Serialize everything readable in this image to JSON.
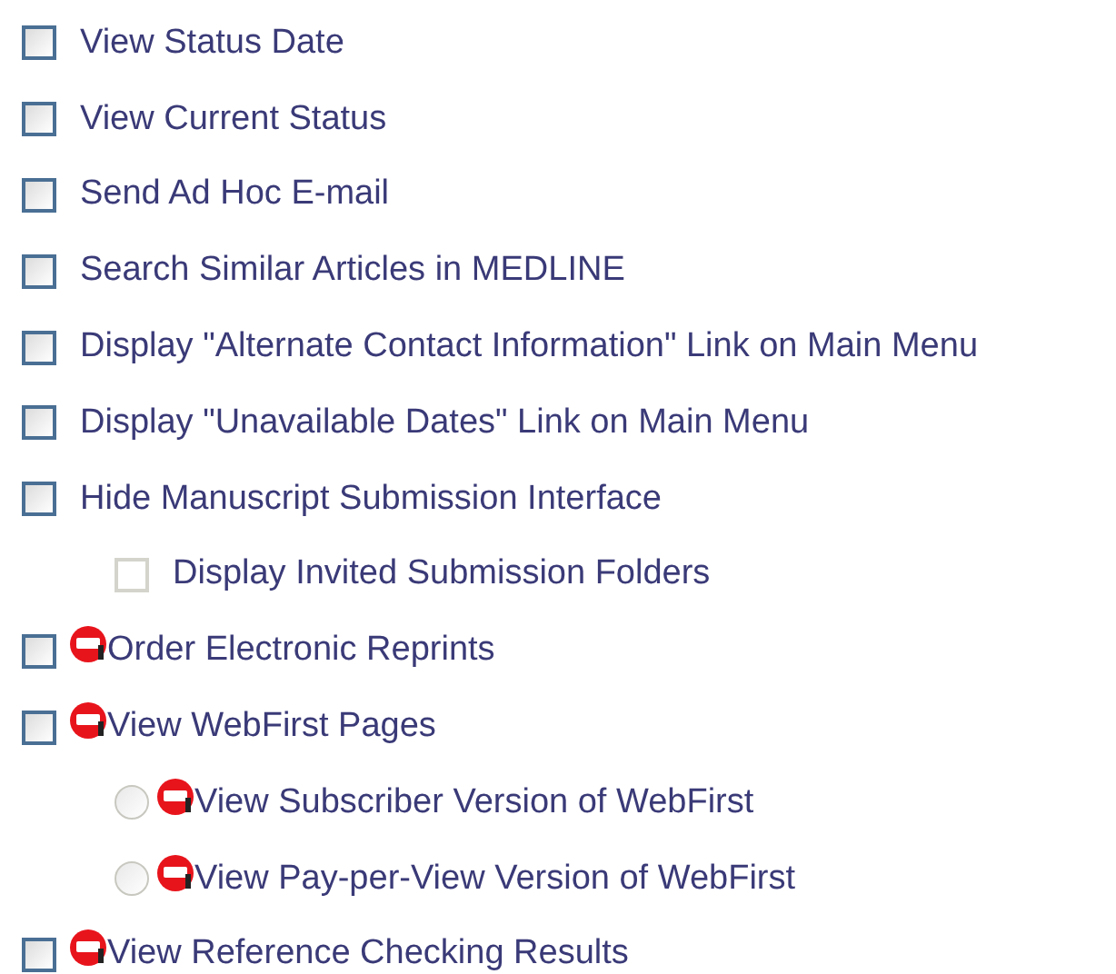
{
  "options": [
    {
      "kind": "checkbox",
      "label": "View Status Date",
      "checked": false,
      "disabled": false,
      "badge": false
    },
    {
      "kind": "checkbox",
      "label": "View Current Status",
      "checked": false,
      "disabled": false,
      "badge": false
    },
    {
      "kind": "checkbox",
      "label": "Send Ad Hoc E-mail",
      "checked": false,
      "disabled": false,
      "badge": false
    },
    {
      "kind": "checkbox",
      "label": "Search Similar Articles in MEDLINE",
      "checked": false,
      "disabled": false,
      "badge": false
    },
    {
      "kind": "checkbox",
      "label": "Display \"Alternate Contact Information\" Link on Main Menu",
      "checked": false,
      "disabled": false,
      "badge": false
    },
    {
      "kind": "checkbox",
      "label": "Display \"Unavailable Dates\" Link on Main Menu",
      "checked": false,
      "disabled": false,
      "badge": false
    },
    {
      "kind": "checkbox",
      "label": "Hide Manuscript Submission Interface",
      "checked": false,
      "disabled": false,
      "badge": false,
      "children": [
        {
          "kind": "checkbox",
          "label": "Display Invited Submission Folders",
          "checked": false,
          "disabled": true,
          "badge": false
        }
      ]
    },
    {
      "kind": "checkbox",
      "label": "Order Electronic Reprints",
      "checked": false,
      "disabled": false,
      "badge": true
    },
    {
      "kind": "checkbox",
      "label": "View WebFirst Pages",
      "checked": false,
      "disabled": false,
      "badge": true,
      "children": [
        {
          "kind": "radio",
          "label": "View Subscriber Version of WebFirst",
          "selected": false,
          "disabled": true,
          "badge": true
        },
        {
          "kind": "radio",
          "label": "View Pay-per-View Version of WebFirst",
          "selected": false,
          "disabled": true,
          "badge": true
        }
      ]
    },
    {
      "kind": "checkbox",
      "label": "View Reference Checking Results",
      "checked": false,
      "disabled": false,
      "badge": true
    }
  ]
}
